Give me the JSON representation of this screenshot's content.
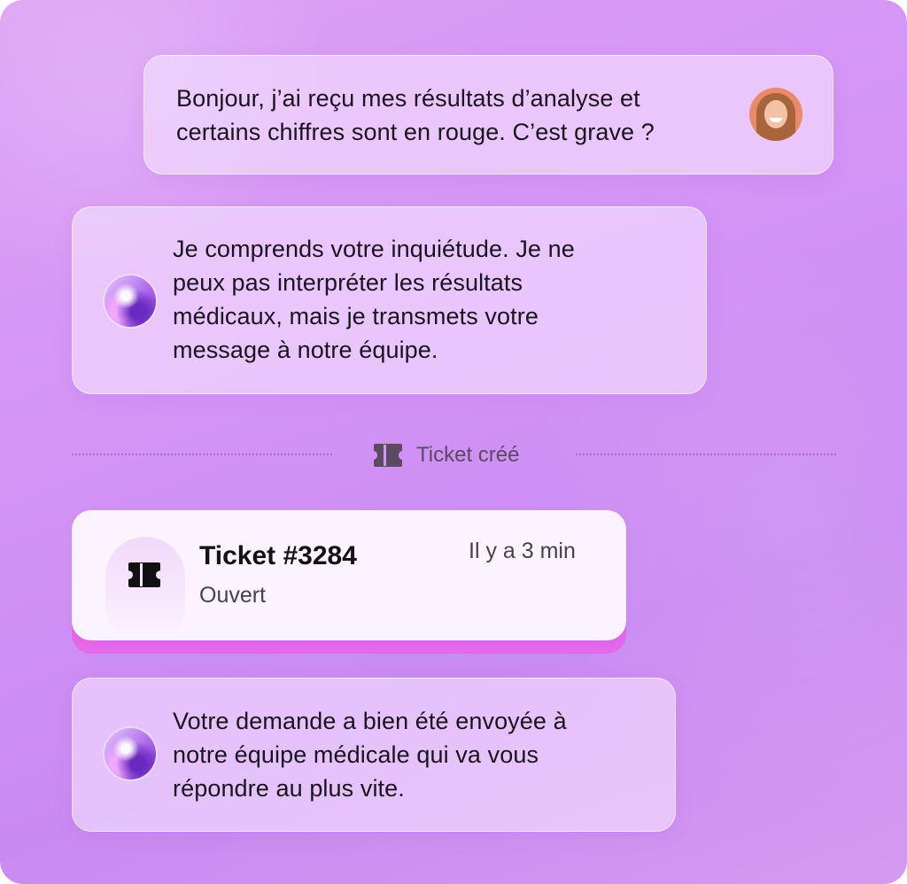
{
  "conversation": {
    "user_message": "Bonjour, j’ai reçu mes résultats d’analyse et\ncertains chiffres sont en rouge. C’est grave ?",
    "bot_reply_1": "Je comprends votre inquiétude. Je ne\npeux pas interpréter les résultats\nmédicaux, mais je transmets votre\nmessage à notre équipe.",
    "divider_label": "Ticket créé",
    "ticket": {
      "title": "Ticket #3284",
      "status": "Ouvert",
      "time": "Il y a 3 min"
    },
    "bot_reply_2": "Votre demande a bien été envoyée à\nnotre équipe médicale qui va vous\nrépondre au plus vite."
  },
  "icons": {
    "user_avatar": "user-avatar",
    "assistant_avatar": "assistant-orb-icon",
    "ticket": "ticket-icon"
  },
  "colors": {
    "background": "#d394f6",
    "ticket_accent": "#e469e9",
    "ticket_card": "#fbf3fd",
    "divider": "#b367c2"
  }
}
